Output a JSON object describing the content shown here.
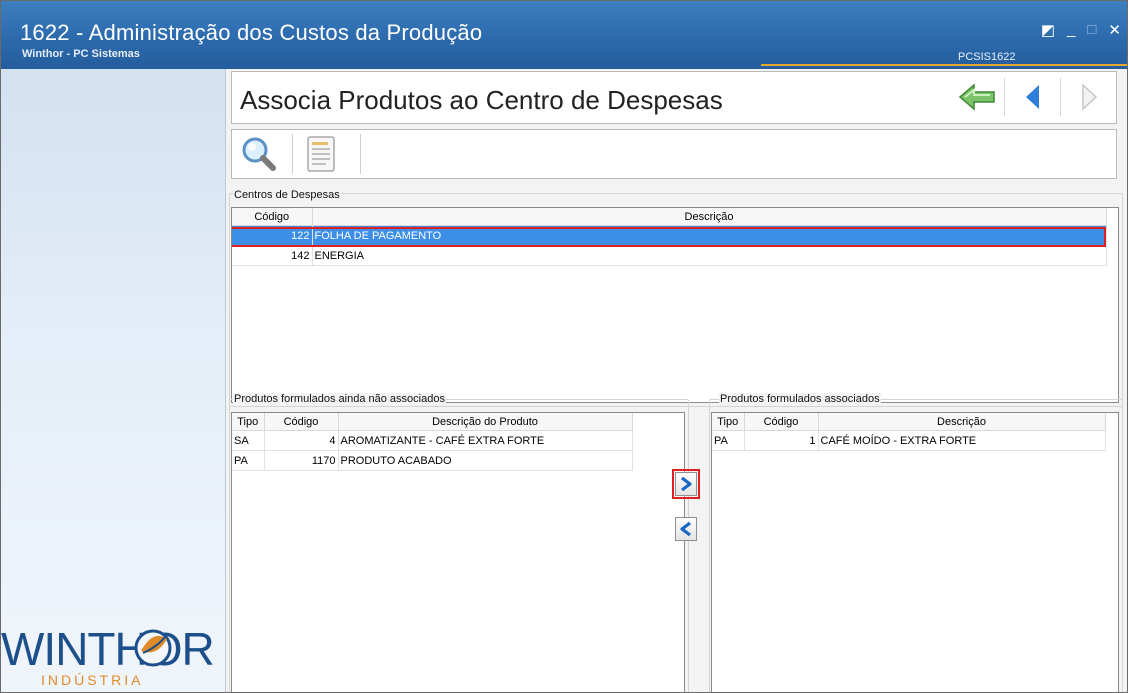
{
  "window": {
    "title": "1622 - Administração dos Custos da Produção",
    "subtitle": "Winthor - PC Sistemas",
    "code": "PCSIS1622",
    "controls": {
      "restore": "◩",
      "minimize": "_",
      "maximize": "□",
      "close": "✕"
    }
  },
  "logo": {
    "brand": "WINTHOR",
    "sub": "INDÚSTRIA"
  },
  "header": {
    "title": "Associa Produtos ao Centro de Despesas"
  },
  "centers": {
    "label": "Centros de Despesas",
    "columns": {
      "codigo": "Código",
      "descricao": "Descrição"
    },
    "rows": [
      {
        "codigo": "122",
        "descricao": "FOLHA DE PAGAMENTO"
      },
      {
        "codigo": "142",
        "descricao": "ENERGIA"
      }
    ]
  },
  "unassociated": {
    "label": "Produtos formulados ainda não associados",
    "columns": {
      "tipo": "Tipo",
      "codigo": "Código",
      "descricao": "Descrição do Produto"
    },
    "rows": [
      {
        "tipo": "SA",
        "codigo": "4",
        "descricao": "AROMATIZANTE - CAFÉ EXTRA FORTE"
      },
      {
        "tipo": "PA",
        "codigo": "1170",
        "descricao": "PRODUTO ACABADO"
      }
    ]
  },
  "associated": {
    "label": "Produtos formulados associados",
    "columns": {
      "tipo": "Tipo",
      "codigo": "Código",
      "descricao": "Descrição"
    },
    "rows": [
      {
        "tipo": "PA",
        "codigo": "1",
        "descricao": "CAFÉ MOÍDO - EXTRA FORTE"
      }
    ]
  },
  "colors": {
    "titlebar": "#2c6aad",
    "selection": "#3d8ee6",
    "highlight": "#e02020",
    "accent": "#e4a733"
  },
  "icons": [
    "search-icon",
    "report-icon",
    "exit-icon",
    "previous-icon",
    "next-icon",
    "move-right-icon",
    "move-left-icon"
  ]
}
